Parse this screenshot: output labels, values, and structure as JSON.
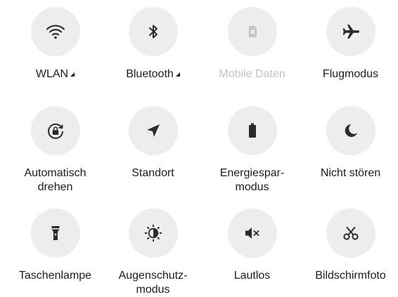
{
  "tiles": [
    {
      "id": "wlan",
      "label": "WLAN",
      "icon": "wifi-icon",
      "has_caret": true,
      "enabled": true
    },
    {
      "id": "bluetooth",
      "label": "Bluetooth",
      "icon": "bluetooth-icon",
      "has_caret": true,
      "enabled": true
    },
    {
      "id": "mobile-data",
      "label": "Mobile Daten",
      "icon": "sim-card-icon",
      "has_caret": false,
      "enabled": false
    },
    {
      "id": "airplane",
      "label": "Flugmodus",
      "icon": "airplane-icon",
      "has_caret": false,
      "enabled": true
    },
    {
      "id": "auto-rotate",
      "label": "Automatisch\ndrehen",
      "icon": "auto-rotate-icon",
      "has_caret": false,
      "enabled": true
    },
    {
      "id": "location",
      "label": "Standort",
      "icon": "location-arrow-icon",
      "has_caret": false,
      "enabled": true
    },
    {
      "id": "battery-saver",
      "label": "Energiespar-\nmodus",
      "icon": "battery-icon",
      "has_caret": false,
      "enabled": true
    },
    {
      "id": "do-not-disturb",
      "label": "Nicht stören",
      "icon": "moon-icon",
      "has_caret": false,
      "enabled": true
    },
    {
      "id": "flashlight",
      "label": "Taschenlampe",
      "icon": "flashlight-icon",
      "has_caret": false,
      "enabled": true
    },
    {
      "id": "eye-comfort",
      "label": "Augenschutz-\nmodus",
      "icon": "eye-comfort-icon",
      "has_caret": false,
      "enabled": true
    },
    {
      "id": "mute",
      "label": "Lautlos",
      "icon": "speaker-mute-icon",
      "has_caret": false,
      "enabled": true
    },
    {
      "id": "screenshot",
      "label": "Bildschirmfoto",
      "icon": "scissors-icon",
      "has_caret": false,
      "enabled": true
    }
  ],
  "colors": {
    "icon": "#2b2b2b",
    "icon_disabled": "#c4c4c4",
    "tile_bg": "#ededed",
    "label": "#1d1d1d",
    "label_disabled": "#c2c2c2"
  }
}
